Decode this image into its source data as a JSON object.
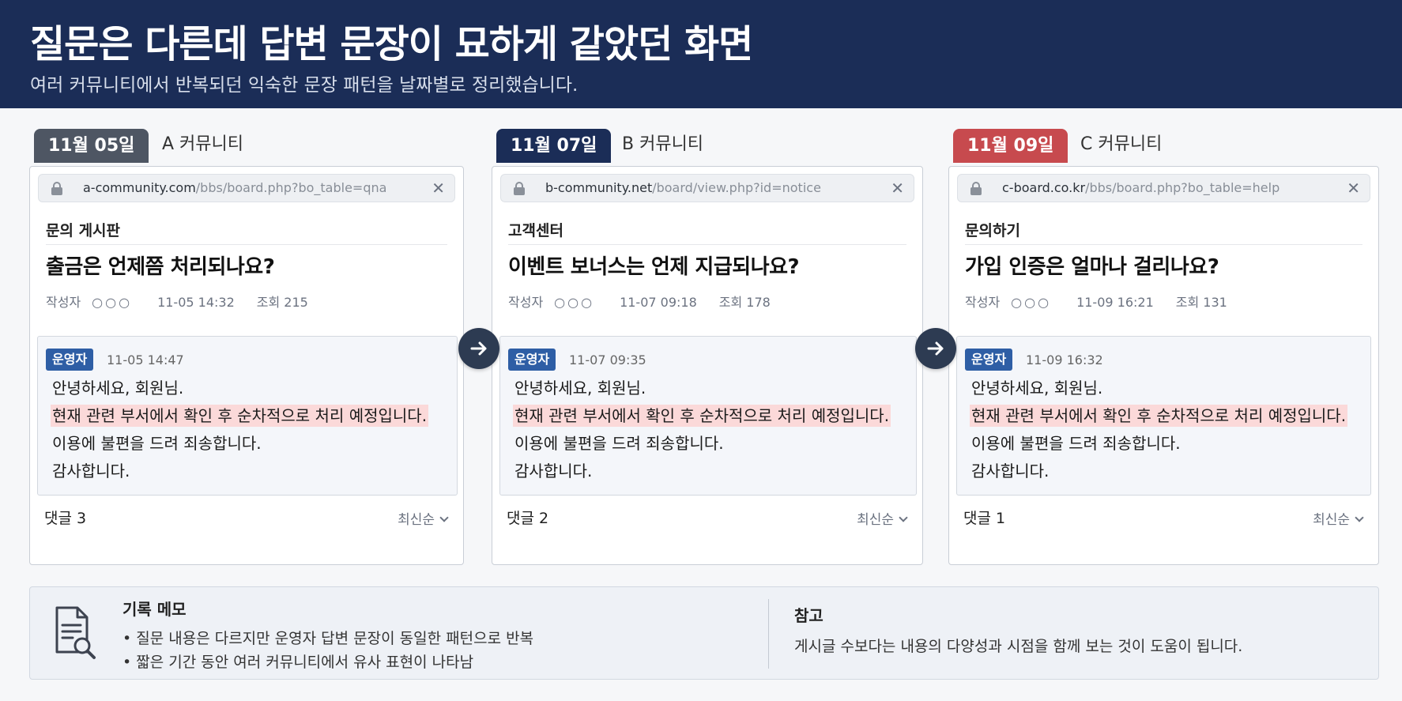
{
  "header": {
    "title": "질문은 다른데 답변 문장이 묘하게 같았던 화면",
    "subtitle": "여러 커뮤니티에서 반복되던 익숙한 문장 패턴을 날짜별로 정리했습니다."
  },
  "colors": {
    "header_bg": "#1b2d57",
    "tab_a": "#4e5663",
    "tab_b": "#1b2d57",
    "tab_c": "#c74a4e",
    "admin_badge": "#2e5ea5",
    "highlight": "#fbd9d9"
  },
  "columns": [
    {
      "date": "11월 05일",
      "community": "A 커뮤니티",
      "url_host": "a-community.com",
      "url_path": "/bbs/board.php?bo_table=qna",
      "board": "문의 게시판",
      "post_title": "출금은 언제쯤 처리되나요?",
      "author_label": "작성자",
      "author_name": "○○○",
      "post_time": "11-05 14:32",
      "views": "조회 215",
      "admin_badge": "운영자",
      "answer_time": "11-05 14:47",
      "answer_lines": [
        "안녕하세요, 회원님.",
        "현재 관련 부서에서 확인 후 순차적으로 처리 예정입니다.",
        "이용에 불편을 드려 죄송합니다.",
        "감사합니다."
      ],
      "comments": "댓글 3",
      "sort": "최신순"
    },
    {
      "date": "11월 07일",
      "community": "B 커뮤니티",
      "url_host": "b-community.net",
      "url_path": "/board/view.php?id=notice",
      "board": "고객센터",
      "post_title": "이벤트 보너스는 언제 지급되나요?",
      "author_label": "작성자",
      "author_name": "○○○",
      "post_time": "11-07 09:18",
      "views": "조회 178",
      "admin_badge": "운영자",
      "answer_time": "11-07 09:35",
      "answer_lines": [
        "안녕하세요, 회원님.",
        "현재 관련 부서에서 확인 후 순차적으로 처리 예정입니다.",
        "이용에 불편을 드려 죄송합니다.",
        "감사합니다."
      ],
      "comments": "댓글 2",
      "sort": "최신순"
    },
    {
      "date": "11월 09일",
      "community": "C 커뮤니티",
      "url_host": "c-board.co.kr",
      "url_path": "/bbs/board.php?bo_table=help",
      "board": "문의하기",
      "post_title": "가입 인증은 얼마나 걸리나요?",
      "author_label": "작성자",
      "author_name": "○○○",
      "post_time": "11-09 16:21",
      "views": "조회 131",
      "admin_badge": "운영자",
      "answer_time": "11-09 16:32",
      "answer_lines": [
        "안녕하세요, 회원님.",
        "현재 관련 부서에서 확인 후 순차적으로 처리 예정입니다.",
        "이용에 불편을 드려 죄송합니다.",
        "감사합니다."
      ],
      "comments": "댓글 1",
      "sort": "최신순"
    }
  ],
  "memo": {
    "title": "기록 메모",
    "bullets": [
      "• 질문 내용은 다르지만 운영자 답변 문장이 동일한 패턴으로 반복",
      "• 짧은 기간 동안 여러 커뮤니티에서 유사 표현이 나타남"
    ],
    "note_title": "참고",
    "note_text": "게시글 수보다는 내용의 다양성과 시점을 함께 보는 것이 도움이 됩니다."
  }
}
